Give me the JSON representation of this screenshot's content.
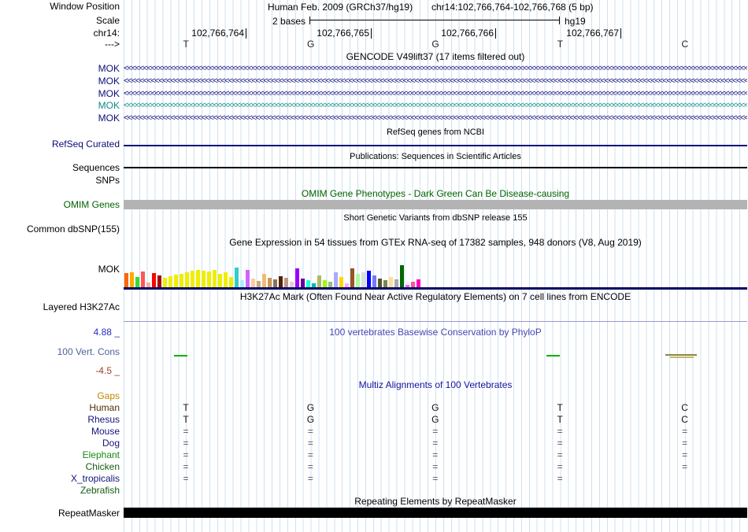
{
  "header": {
    "window_position_label": "Window Position",
    "assembly": "Human Feb. 2009 (GRCh37/hg19)",
    "position": "chr14:102,766,764-102,766,768 (5 bp)",
    "scale_label": "Scale",
    "scale_value": "2 bases",
    "genome": "hg19",
    "chrom_label": "chr14:",
    "position_ticks": [
      "102,766,764",
      "102,766,765",
      "102,766,766",
      "102,766,767"
    ],
    "strand_label": "--->",
    "bases": [
      "T",
      "G",
      "G",
      "T",
      "C"
    ]
  },
  "tracks": {
    "gencode": {
      "title": "GENCODE V49lift37 (17 items filtered out)",
      "arrow_char": "<",
      "items": [
        {
          "label": "MOK",
          "color": "#0c0c78"
        },
        {
          "label": "MOK",
          "color": "#0c0c78"
        },
        {
          "label": "MOK",
          "color": "#0c0c78"
        },
        {
          "label": "MOK",
          "color": "#0e8888"
        },
        {
          "label": "MOK",
          "color": "#0c0c78"
        }
      ]
    },
    "refseq": {
      "title": "RefSeq genes from NCBI",
      "label": "RefSeq Curated",
      "color": "#0c0c78"
    },
    "publications": {
      "title": "Publications: Sequences in Scientific Articles",
      "label": "Sequences",
      "color": "#000000"
    },
    "snps": {
      "label": "SNPs"
    },
    "omim": {
      "title": "OMIM Gene Phenotypes - Dark Green Can Be Disease-causing",
      "label": "OMIM Genes",
      "title_color": "#006400",
      "bar_color": "#b3b3b3"
    },
    "dbsnp": {
      "title": "Short Genetic Variants from dbSNP release 155",
      "label": "Common dbSNP(155)"
    },
    "gtex": {
      "title": "Gene Expression in 54 tissues from GTEx RNA-seq of 17382 samples, 948 donors (V8, Aug 2019)",
      "label": "MOK",
      "baseline_color": "#000064",
      "bars": [
        [
          "#FF6600",
          18
        ],
        [
          "#FFAA00",
          19
        ],
        [
          "#33DD33",
          13
        ],
        [
          "#FF5555",
          20
        ],
        [
          "#FFAA99",
          6
        ],
        [
          "#FF0000",
          18
        ],
        [
          "#AA0000",
          15
        ],
        [
          "#EEEE00",
          12
        ],
        [
          "#EEEE00",
          14
        ],
        [
          "#EEEE00",
          16
        ],
        [
          "#EEEE00",
          17
        ],
        [
          "#EEEE00",
          19
        ],
        [
          "#EEEE00",
          21
        ],
        [
          "#EEEE00",
          22
        ],
        [
          "#EEEE00",
          21
        ],
        [
          "#EEEE00",
          20
        ],
        [
          "#EEEE00",
          22
        ],
        [
          "#EEEE00",
          17
        ],
        [
          "#EEEE00",
          19
        ],
        [
          "#EEEE00",
          13
        ],
        [
          "#33CCCC",
          25
        ],
        [
          "#AAEEFF",
          9
        ],
        [
          "#CC66FF",
          22
        ],
        [
          "#FFCC99",
          11
        ],
        [
          "#CCAA77",
          8
        ],
        [
          "#EEBB77",
          17
        ],
        [
          "#CC9955",
          12
        ],
        [
          "#8B7355",
          10
        ],
        [
          "#552200",
          14
        ],
        [
          "#BB9988",
          12
        ],
        [
          "#EECCCC",
          7
        ],
        [
          "#9900FF",
          24
        ],
        [
          "#660099",
          11
        ],
        [
          "#22FFDD",
          9
        ],
        [
          "#00BBAA",
          5
        ],
        [
          "#AABB66",
          15
        ],
        [
          "#99FF00",
          9
        ],
        [
          "#99BB88",
          7
        ],
        [
          "#AAAAFF",
          19
        ],
        [
          "#FFD700",
          13
        ],
        [
          "#FFAAFF",
          5
        ],
        [
          "#995522",
          24
        ],
        [
          "#AAFF99",
          17
        ],
        [
          "#DDDDDD",
          19
        ],
        [
          "#0000FF",
          21
        ],
        [
          "#7777FF",
          15
        ],
        [
          "#555522",
          11
        ],
        [
          "#778855",
          9
        ],
        [
          "#FFDD99",
          13
        ],
        [
          "#AAAAAA",
          10
        ],
        [
          "#006600",
          28
        ],
        [
          "#FF66FF",
          3
        ],
        [
          "#FF5599",
          7
        ],
        [
          "#FF00BB",
          10
        ]
      ]
    },
    "h3k27ac": {
      "title": "H3K27Ac Mark (Often Found Near Active Regulatory Elements) on 7 cell lines from ENCODE",
      "label": "Layered H3K27Ac",
      "line_color": "#9999cc"
    },
    "phylop": {
      "title": "100 vertebrates Basewise Conservation by PhyloP",
      "title_color": "#4646b4",
      "label": "100 Vert. Cons",
      "label_color": "#50649b",
      "max_label": "4.88 _",
      "max_color": "#2d2dc8",
      "min_label": "-4.5 _",
      "min_color": "#a03c28",
      "marks": [
        [
          221,
          451,
          17,
          2,
          "#00b400"
        ],
        [
          694,
          451,
          17,
          2,
          "#00b400"
        ],
        [
          845,
          450,
          40,
          2,
          "#8a8a3c"
        ],
        [
          851,
          453,
          30,
          2,
          "#c3b873"
        ]
      ]
    },
    "multiz": {
      "title": "Multiz Alignments of 100 Vertebrates",
      "title_color": "#1414a0",
      "rows": [
        {
          "label": "Gaps",
          "color": "#c08a00",
          "cells": [
            "",
            "",
            "",
            "",
            ""
          ]
        },
        {
          "label": "Human",
          "color": "#4d3000",
          "cells": [
            "T",
            "G",
            "G",
            "T",
            "C"
          ]
        },
        {
          "label": "Rhesus",
          "color": "#14147c",
          "cells": [
            "T",
            "G",
            "G",
            "T",
            "C"
          ]
        },
        {
          "label": "Mouse",
          "color": "#14147c",
          "cells": [
            "=",
            "=",
            "=",
            "=",
            "="
          ]
        },
        {
          "label": "Dog",
          "color": "#14147c",
          "cells": [
            "=",
            "=",
            "=",
            "=",
            "="
          ]
        },
        {
          "label": "Elephant",
          "color": "#148c14",
          "cells": [
            "=",
            "=",
            "=",
            "=",
            "="
          ]
        },
        {
          "label": "Chicken",
          "color": "#145c14",
          "cells": [
            "=",
            "=",
            "=",
            "=",
            "="
          ]
        },
        {
          "label": "X_tropicalis",
          "color": "#14147c",
          "cells": [
            "=",
            "=",
            "=",
            "=",
            ""
          ]
        },
        {
          "label": "Zebrafish",
          "color": "#145c14",
          "cells": [
            "",
            "",
            "",
            "",
            ""
          ]
        }
      ]
    },
    "repeatmasker": {
      "title": "Repeating Elements by RepeatMasker",
      "label": "RepeatMasker",
      "bar_color": "#000000"
    }
  }
}
